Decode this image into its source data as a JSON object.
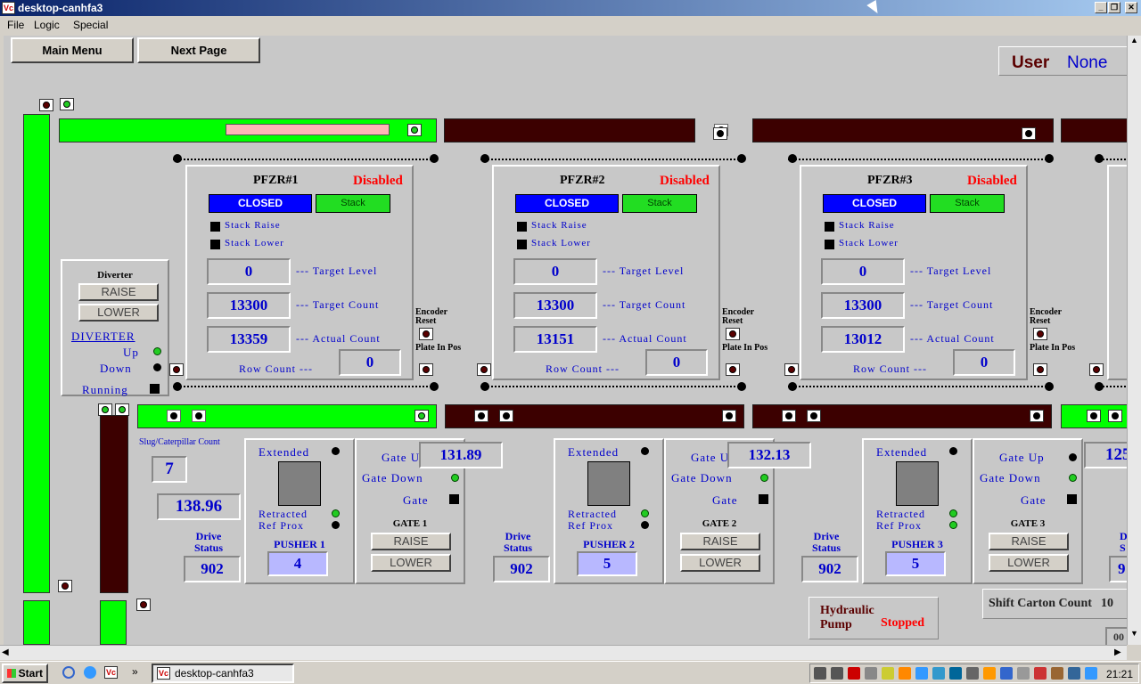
{
  "window": {
    "title": "desktop-canhfa3",
    "app_icon": "Vc"
  },
  "menu": [
    "File",
    "Logic",
    "Special"
  ],
  "buttons": {
    "main_menu": "Main Menu",
    "next_page": "Next Page"
  },
  "user": {
    "label": "User",
    "value": "None"
  },
  "diverter": {
    "title": "Diverter",
    "raise": "RAISE",
    "lower": "LOWER",
    "label": "DIVERTER",
    "up": "Up",
    "down": "Down",
    "running": "Running"
  },
  "pfzr": [
    {
      "name": "PFZR#1",
      "status": "Disabled",
      "closed": "CLOSED",
      "stack": "Stack",
      "stack_raise": "Stack Raise",
      "stack_lower": "Stack Lower",
      "target_level": "0",
      "target_level_label": "--- Target Level",
      "target_count": "13300",
      "target_count_label": "--- Target Count",
      "actual_count": "13359",
      "actual_count_label": "--- Actual Count",
      "row_count_label": "Row Count ---",
      "row_count": "0"
    },
    {
      "name": "PFZR#2",
      "status": "Disabled",
      "closed": "CLOSED",
      "stack": "Stack",
      "stack_raise": "Stack Raise",
      "stack_lower": "Stack Lower",
      "target_level": "0",
      "target_level_label": "--- Target Level",
      "target_count": "13300",
      "target_count_label": "--- Target Count",
      "actual_count": "13151",
      "actual_count_label": "--- Actual Count",
      "row_count_label": "Row Count ---",
      "row_count": "0"
    },
    {
      "name": "PFZR#3",
      "status": "Disabled",
      "closed": "CLOSED",
      "stack": "Stack",
      "stack_raise": "Stack Raise",
      "stack_lower": "Stack Lower",
      "target_level": "0",
      "target_level_label": "--- Target Level",
      "target_count": "13300",
      "target_count_label": "--- Target Count",
      "actual_count": "13012",
      "actual_count_label": "--- Actual Count",
      "row_count_label": "Row Count ---",
      "row_count": "0"
    }
  ],
  "encoder": {
    "encoder_reset": "Encoder Reset",
    "plate_in_pos": "Plate In Pos"
  },
  "slug": {
    "label": "Slug/Caterpillar Count",
    "value": "7",
    "drive_value": "138.96"
  },
  "stations": [
    {
      "speed": "",
      "drive_status_label": "Drive Status",
      "drive_status": "902",
      "extended": "Extended",
      "retracted": "Retracted",
      "ref_prox": "Ref Prox",
      "pusher": "PUSHER 1",
      "pusher_val": "4",
      "gate_up": "Gate Up",
      "gate_down": "Gate Down",
      "gate": "Gate",
      "gate_name": "GATE 1",
      "raise": "RAISE",
      "lower": "LOWER"
    },
    {
      "speed": "131.89",
      "drive_status_label": "Drive Status",
      "drive_status": "902",
      "extended": "Extended",
      "retracted": "Retracted",
      "ref_prox": "Ref Prox",
      "pusher": "PUSHER 2",
      "pusher_val": "5",
      "gate_up": "Gate Up",
      "gate_down": "Gate Down",
      "gate": "Gate",
      "gate_name": "GATE 2",
      "raise": "RAISE",
      "lower": "LOWER"
    },
    {
      "speed": "132.13",
      "drive_status_label": "Drive Status",
      "drive_status": "902",
      "extended": "Extended",
      "retracted": "Retracted",
      "ref_prox": "Ref Prox",
      "pusher": "PUSHER 3",
      "pusher_val": "5",
      "gate_up": "Gate Up",
      "gate_down": "Gate Down",
      "gate": "Gate",
      "gate_name": "GATE 3",
      "raise": "RAISE",
      "lower": "LOWER"
    }
  ],
  "partial": {
    "speed": "125.",
    "drive": "D",
    "status": "S",
    "val": "9"
  },
  "hydraulic": {
    "label": "Hydraulic Pump",
    "status": "Stopped"
  },
  "shift": {
    "label": "Shift Carton Count",
    "value": "10"
  },
  "partial_box": "00",
  "taskbar": {
    "start": "Start",
    "task": "desktop-canhfa3",
    "clock": "21:21",
    "more": "»"
  },
  "colors": {
    "green": "#00ff00",
    "maroon": "#3c0000",
    "blue": "#0000cc",
    "red": "#ff0000"
  }
}
